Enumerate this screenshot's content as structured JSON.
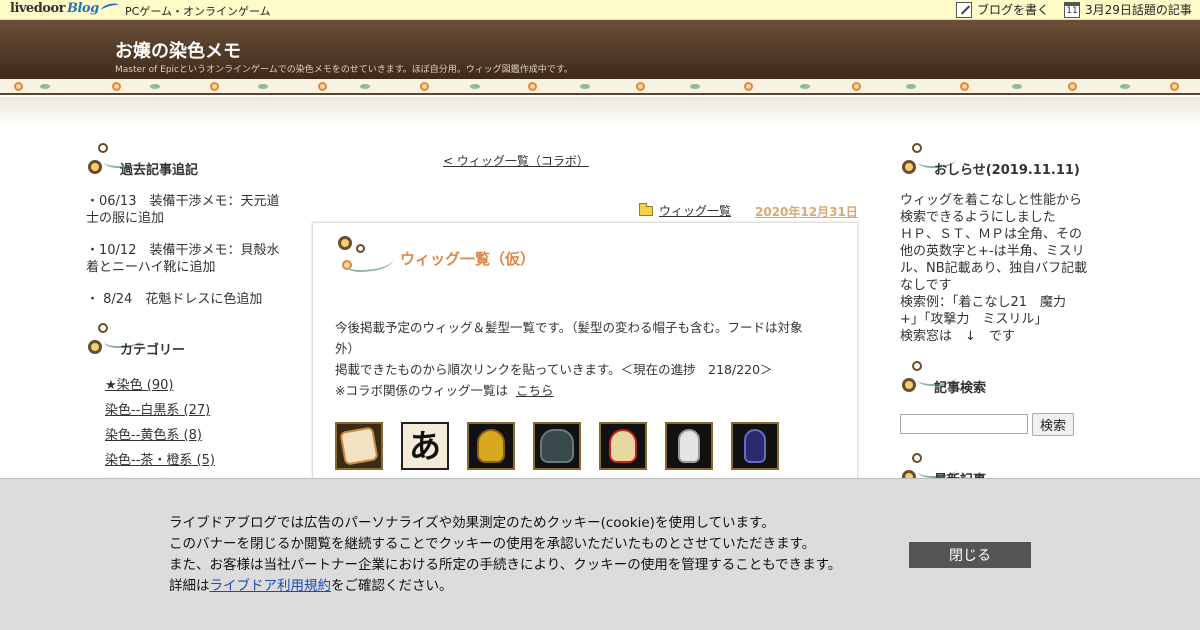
{
  "topbar": {
    "logo_main": "livedoor",
    "logo_blog": "Blog",
    "category": "PCゲーム・オンラインゲーム",
    "write_blog": "ブログを書く",
    "hot_topics": "3月29日話題の記事",
    "calendar_day": "11"
  },
  "header": {
    "title": "お嬢の染色メモ",
    "description": "Master of Epicというオンラインゲームでの染色メモをのせていきます。ほぼ自分用。ウィッグ図鑑作成中です。"
  },
  "left_sidebar": {
    "recent_title": "過去記事追記",
    "recent_items": [
      "・06/13　装備干渉メモ：天元道士の服に追加",
      "・10/12　装備干渉メモ：貝殻水着とニーハイ靴に追加",
      "・ 8/24　花魁ドレスに色追加"
    ],
    "category_title": "カテゴリー",
    "categories": [
      "★染色 (90)",
      "染色--白黒系 (27)",
      "染色--黄色系 (8)",
      "染色--茶・橙系 (5)",
      "染色--赤系 (4)"
    ]
  },
  "main": {
    "prev_link": "< ウィッグ一覧（コラボ）",
    "post_category": "ウィッグ一覧",
    "post_date": "2020年12月31日",
    "post_title": "ウィッグ一覧（仮）",
    "lines": [
      "今後掲載予定のウィッグ＆髪型一覧です。（髪型の変わる帽子も含む。フードは対象",
      "外）",
      "掲載できたものから順次リンクを貼っていきます。＜現在の進捗　218/220＞",
      "※コラボ関係のウィッグ一覧は"
    ],
    "here_link": "こちら",
    "thumb_glyph": "あ"
  },
  "right_sidebar": {
    "notice_title": "おしらせ(2019.11.11)",
    "notice_lines": [
      "ウィッグを着こなしと性能から",
      "検索できるようにしました",
      "ＨＰ、ＳＴ、ＭＰは全角、その",
      "他の英数字と+-は半角、ミスリ",
      "ル、NB記載あり、独自バフ記載",
      "なしです",
      "検索例：「着こなし21　魔力",
      "+」「攻撃力　ミスリル」",
      "検索窓は　↓　です"
    ],
    "search_title": "記事検索",
    "search_button": "検索",
    "latest_title": "最新記事"
  },
  "cookie": {
    "line1": "ライブドアブログでは広告のパーソナライズや効果測定のためクッキー(cookie)を使用しています。",
    "line2": "このバナーを閉じるか閲覧を継続することでクッキーの使用を承認いただいたものとさせていただきます。",
    "line3": "また、お客様は当社パートナー企業における所定の手続きにより、クッキーの使用を管理することもできます。",
    "line4_prefix": "詳細は",
    "line4_link": "ライブドア利用規約",
    "line4_suffix": "をご確認ください。",
    "close_button": "閉じる"
  },
  "colors": {
    "accent_title": "#e0884a",
    "header_brown": "#4e3826",
    "topbar_yellow": "#fefbc8"
  }
}
